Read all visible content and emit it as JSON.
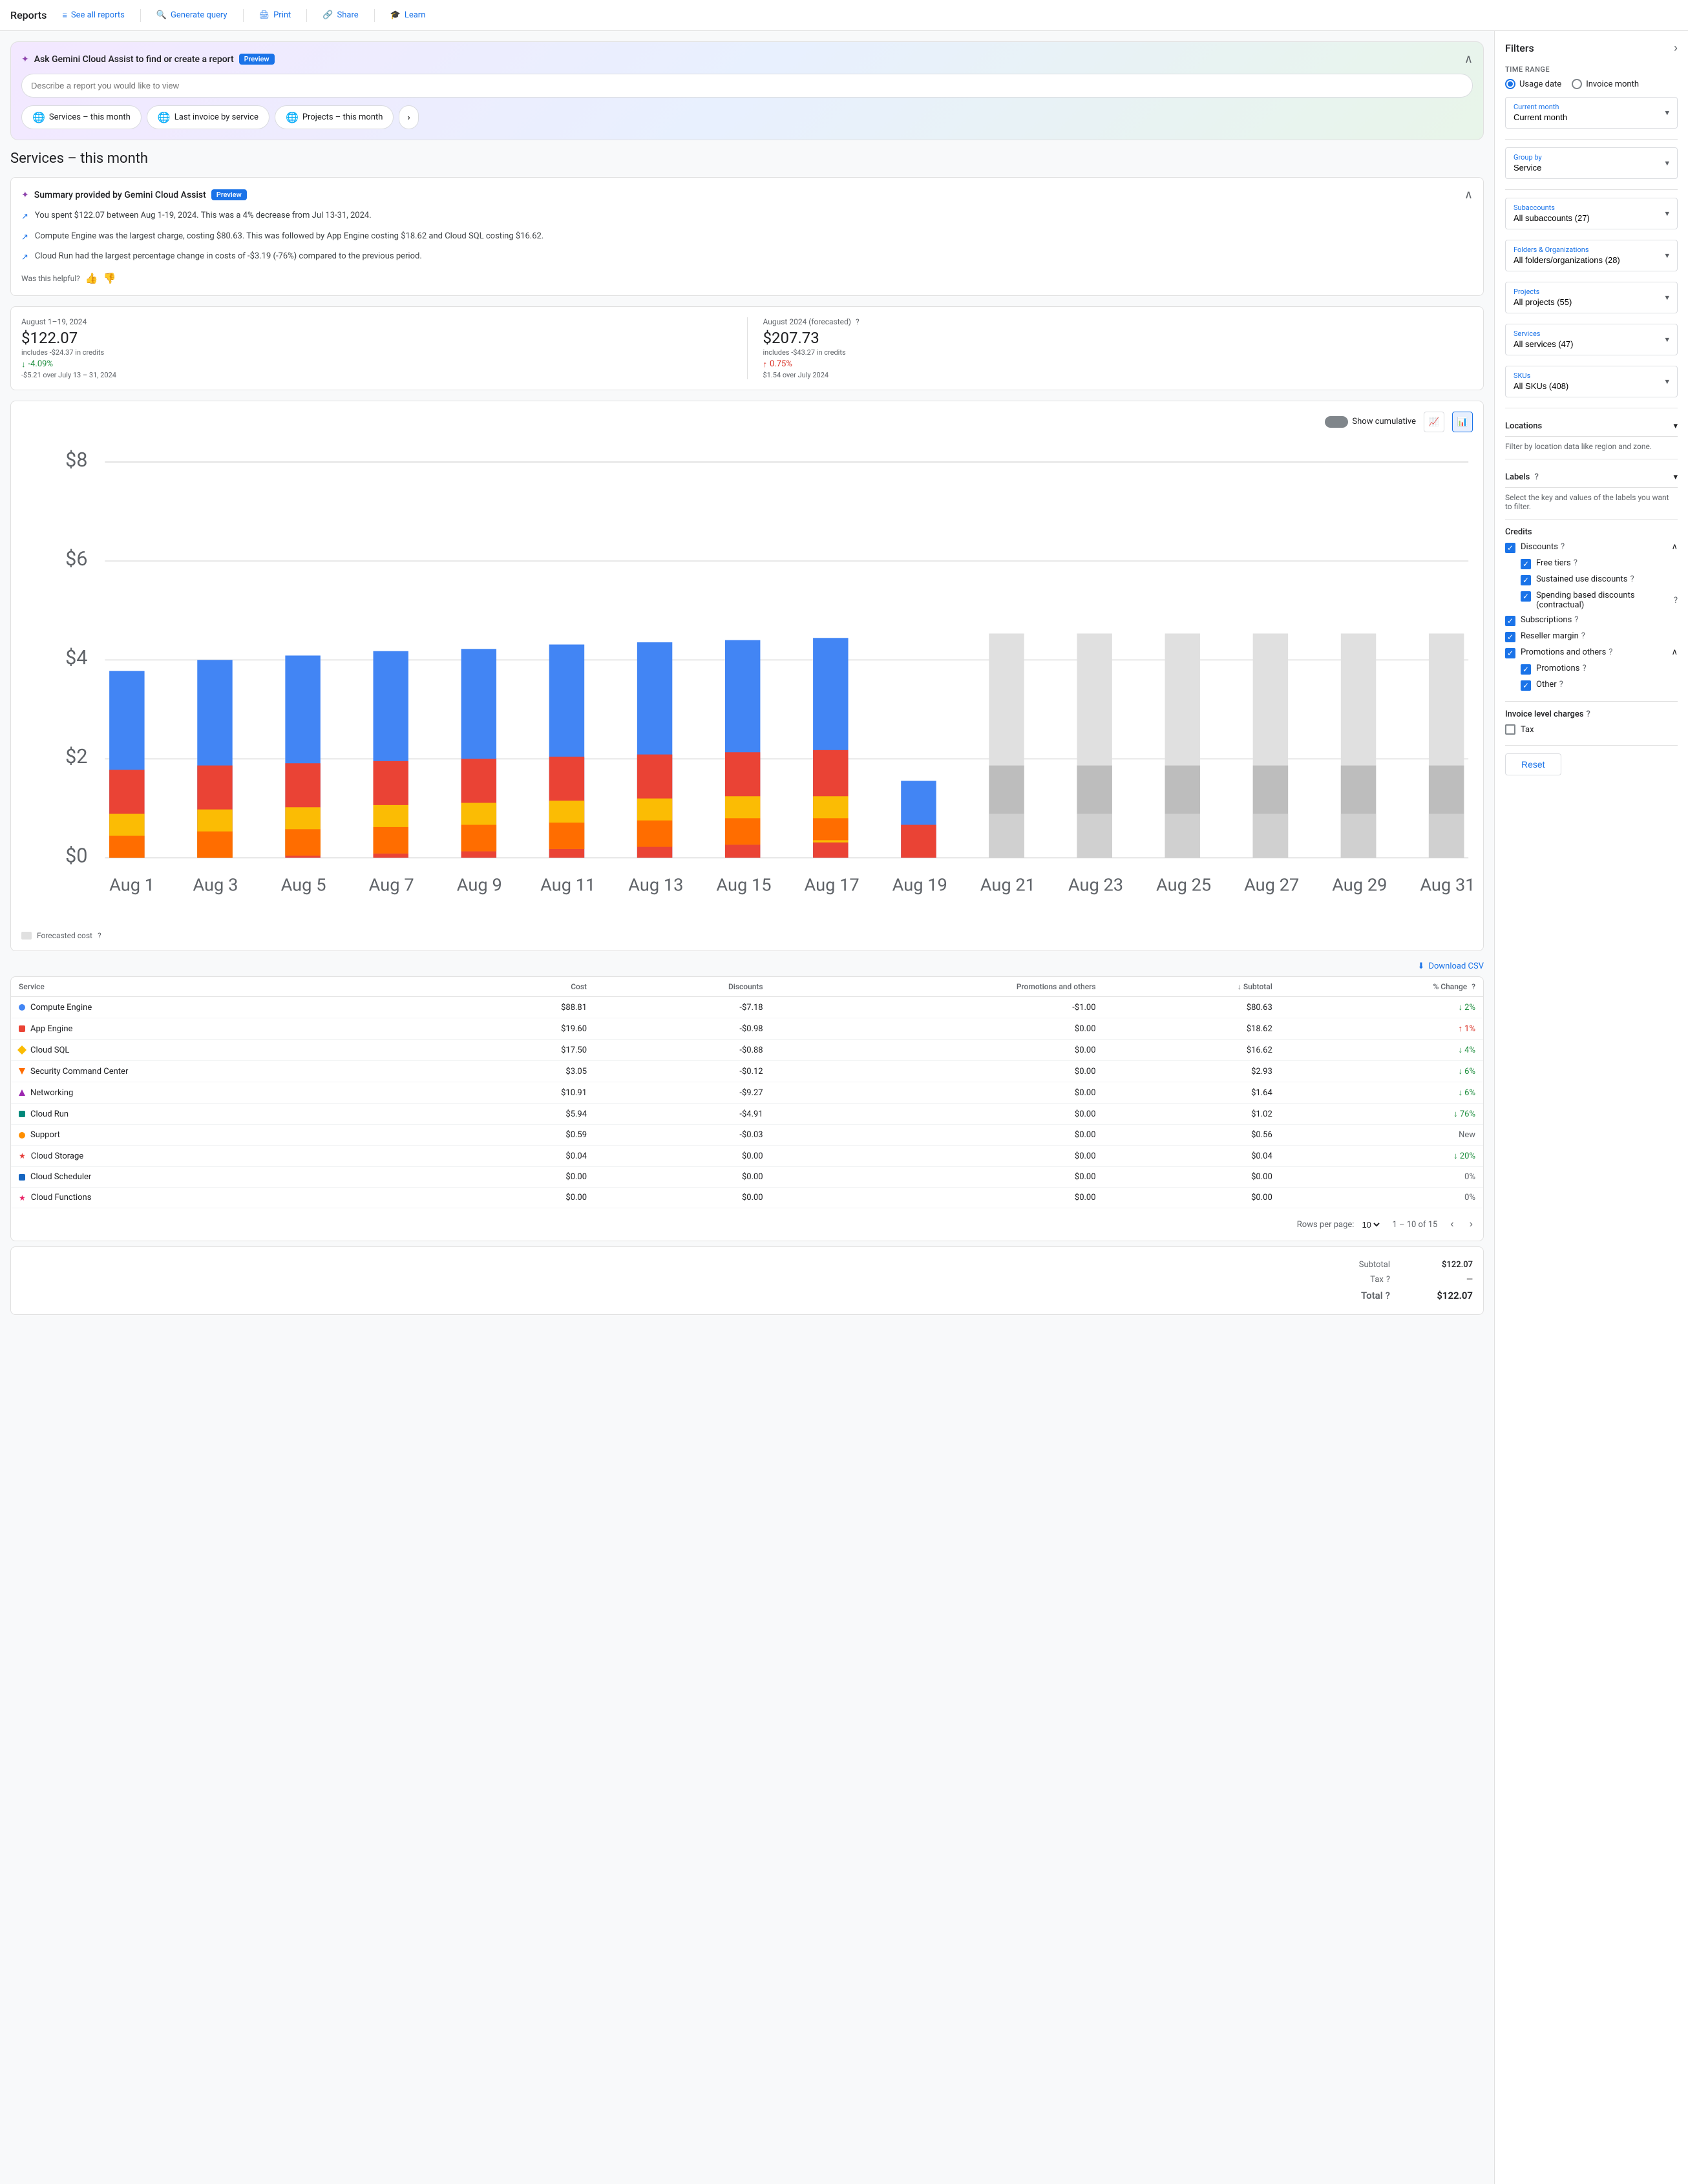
{
  "nav": {
    "title": "Reports",
    "links": [
      {
        "id": "see-all-reports",
        "label": "See all reports",
        "icon": "≡"
      },
      {
        "id": "generate-query",
        "label": "Generate query",
        "icon": "🔍"
      },
      {
        "id": "print",
        "label": "Print",
        "icon": "🖨"
      },
      {
        "id": "share",
        "label": "Share",
        "icon": "🔗"
      },
      {
        "id": "learn",
        "label": "Learn",
        "icon": "🎓"
      }
    ]
  },
  "gemini": {
    "title": "Ask Gemini Cloud Assist to find or create a report",
    "preview_label": "Preview",
    "input_placeholder": "Describe a report you would like to view",
    "chips": [
      {
        "id": "services-month",
        "label": "Services – this month"
      },
      {
        "id": "last-invoice",
        "label": "Last invoice by service"
      },
      {
        "id": "projects-month",
        "label": "Projects – this month"
      }
    ]
  },
  "page": {
    "title": "Services – this month"
  },
  "summary": {
    "title": "Summary provided by Gemini Cloud Assist",
    "preview_label": "Preview",
    "items": [
      "You spent $122.07 between Aug 1-19, 2024. This was a 4% decrease from Jul 13-31, 2024.",
      "Compute Engine was the largest charge, costing $80.63. This was followed by App Engine costing $18.62 and Cloud SQL costing $16.62.",
      "Cloud Run had the largest percentage change in costs of -$3.19 (-76%) compared to the previous period."
    ],
    "feedback_label": "Was this helpful?"
  },
  "metrics": {
    "current": {
      "period": "August 1–19, 2024",
      "value": "$122.07",
      "sub": "includes -$24.37 in credits",
      "change_pct": "-4.09%",
      "change_desc": "-$5.21 over July 13 – 31, 2024",
      "change_dir": "down"
    },
    "forecast": {
      "period": "August 2024 (forecasted)",
      "value": "$207.73",
      "sub": "includes -$43.27 in credits",
      "change_pct": "0.75%",
      "change_desc": "$1.54 over July 2024",
      "change_dir": "up"
    }
  },
  "chart": {
    "show_cumulative_label": "Show cumulative",
    "y_labels": [
      "$8",
      "$6",
      "$4",
      "$2",
      "$0"
    ],
    "x_labels": [
      "Aug 1",
      "Aug 3",
      "Aug 5",
      "Aug 7",
      "Aug 9",
      "Aug 11",
      "Aug 13",
      "Aug 15",
      "Aug 17",
      "Aug 19",
      "Aug 21",
      "Aug 23",
      "Aug 25",
      "Aug 27",
      "Aug 29",
      "Aug 31"
    ],
    "forecast_legend": "Forecasted cost"
  },
  "table": {
    "download_label": "Download CSV",
    "headers": [
      "Service",
      "Cost",
      "Discounts",
      "Promotions and others",
      "Subtotal",
      "% Change"
    ],
    "rows": [
      {
        "name": "Compute Engine",
        "color": "#4285f4",
        "shape": "circle",
        "cost": "$88.81",
        "discounts": "-$7.18",
        "promotions": "-$1.00",
        "subtotal": "$80.63",
        "change": "2%",
        "change_dir": "down"
      },
      {
        "name": "App Engine",
        "color": "#ea4335",
        "shape": "square",
        "cost": "$19.60",
        "discounts": "-$0.98",
        "promotions": "$0.00",
        "subtotal": "$18.62",
        "change": "1%",
        "change_dir": "up"
      },
      {
        "name": "Cloud SQL",
        "color": "#fbbc04",
        "shape": "diamond",
        "cost": "$17.50",
        "discounts": "-$0.88",
        "promotions": "$0.00",
        "subtotal": "$16.62",
        "change": "4%",
        "change_dir": "down"
      },
      {
        "name": "Security Command Center",
        "color": "#ff6d00",
        "shape": "triangle-down",
        "cost": "$3.05",
        "discounts": "-$0.12",
        "promotions": "$0.00",
        "subtotal": "$2.93",
        "change": "6%",
        "change_dir": "down"
      },
      {
        "name": "Networking",
        "color": "#9c27b0",
        "shape": "triangle-up",
        "cost": "$10.91",
        "discounts": "-$9.27",
        "promotions": "$0.00",
        "subtotal": "$1.64",
        "change": "6%",
        "change_dir": "down"
      },
      {
        "name": "Cloud Run",
        "color": "#00897b",
        "shape": "square",
        "cost": "$5.94",
        "discounts": "-$4.91",
        "promotions": "$0.00",
        "subtotal": "$1.02",
        "change": "76%",
        "change_dir": "down"
      },
      {
        "name": "Support",
        "color": "#ff8f00",
        "shape": "circle",
        "cost": "$0.59",
        "discounts": "-$0.03",
        "promotions": "$0.00",
        "subtotal": "$0.56",
        "change": "New",
        "change_dir": "neutral"
      },
      {
        "name": "Cloud Storage",
        "color": "#e53935",
        "shape": "star",
        "cost": "$0.04",
        "discounts": "$0.00",
        "promotions": "$0.00",
        "subtotal": "$0.04",
        "change": "20%",
        "change_dir": "down"
      },
      {
        "name": "Cloud Scheduler",
        "color": "#1565c0",
        "shape": "square",
        "cost": "$0.00",
        "discounts": "$0.00",
        "promotions": "$0.00",
        "subtotal": "$0.00",
        "change": "0%",
        "change_dir": "neutral"
      },
      {
        "name": "Cloud Functions",
        "color": "#e91e63",
        "shape": "star",
        "cost": "$0.00",
        "discounts": "$0.00",
        "promotions": "$0.00",
        "subtotal": "$0.00",
        "change": "0%",
        "change_dir": "neutral"
      }
    ],
    "pagination": {
      "rows_per_page_label": "Rows per page:",
      "rows_per_page": "10",
      "range": "1 – 10 of 15"
    }
  },
  "totals": {
    "subtotal_label": "Subtotal",
    "subtotal_value": "$122.07",
    "tax_label": "Tax",
    "tax_value": "—",
    "total_label": "Total",
    "total_value": "$122.07"
  },
  "filters": {
    "title": "Filters",
    "time_range_label": "Time range",
    "usage_date_label": "Usage date",
    "invoice_month_label": "Invoice month",
    "current_month_label": "Current month",
    "group_by_label": "Group by",
    "group_by_value": "Service",
    "subaccounts_label": "Subaccounts",
    "subaccounts_value": "All subaccounts (27)",
    "folders_label": "Folders & Organizations",
    "folders_value": "All folders/organizations (28)",
    "projects_label": "Projects",
    "projects_value": "All projects (55)",
    "services_label": "Services",
    "services_value": "All services (47)",
    "skus_label": "SKUs",
    "skus_value": "All SKUs (408)",
    "locations_label": "Locations",
    "locations_desc": "Filter by location data like region and zone.",
    "labels_label": "Labels",
    "credits_label": "Credits",
    "discounts_label": "Discounts",
    "free_tiers_label": "Free tiers",
    "sustained_use_label": "Sustained use discounts",
    "spending_based_label": "Spending based discounts (contractual)",
    "subscriptions_label": "Subscriptions",
    "reseller_margin_label": "Reseller margin",
    "promotions_label": "Promotions and others",
    "promotions_sub_label": "Promotions",
    "other_label": "Other",
    "invoice_charges_label": "Invoice level charges",
    "tax_label": "Tax",
    "reset_label": "Reset"
  }
}
